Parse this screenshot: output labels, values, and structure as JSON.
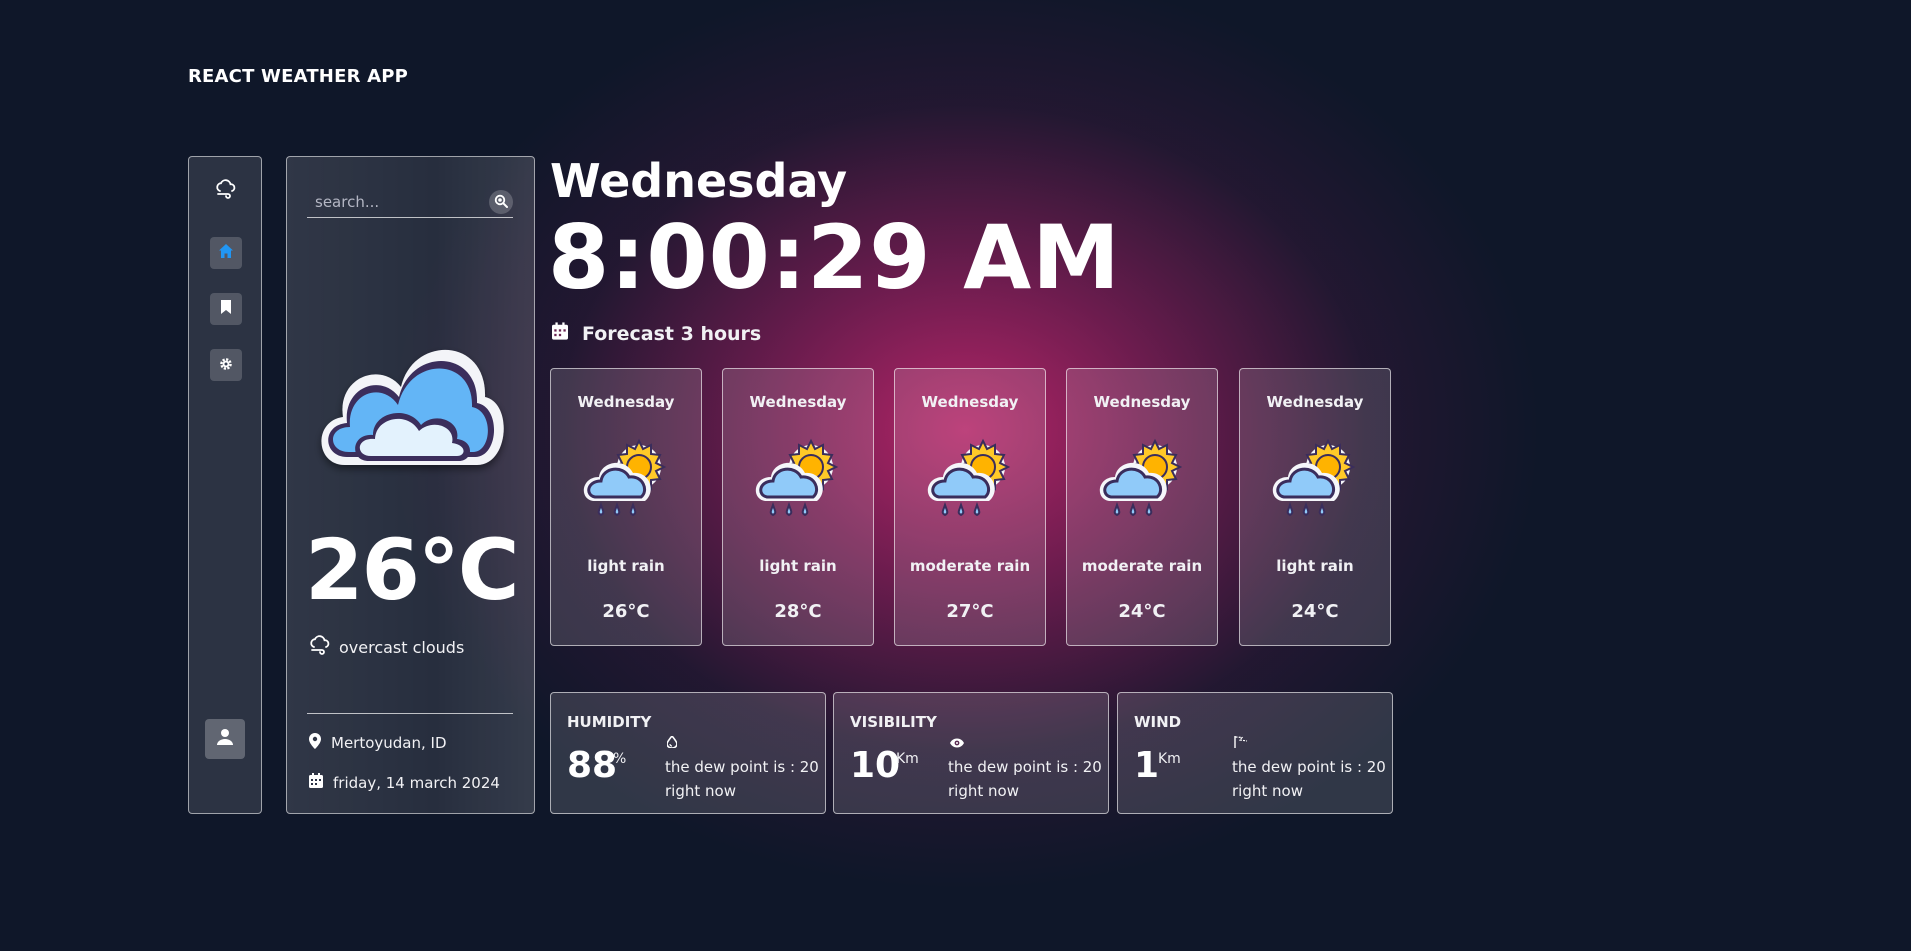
{
  "app": {
    "title": "REACT WEATHER APP"
  },
  "nav": {
    "items": [
      {
        "icon": "cloud-wind-icon"
      },
      {
        "icon": "home-icon",
        "active": true
      },
      {
        "icon": "bookmark-icon"
      },
      {
        "icon": "gear-icon"
      }
    ],
    "avatar_icon": "user-icon"
  },
  "search": {
    "placeholder": "search..."
  },
  "current": {
    "temperature": "26°C",
    "condition": "overcast clouds",
    "location": "Mertoyudan, ID",
    "date": "friday, 14 march 2024"
  },
  "header": {
    "day": "Wednesday",
    "time": "8:00:29 AM"
  },
  "forecast": {
    "title": "Forecast 3 hours",
    "items": [
      {
        "day": "Wednesday",
        "desc": "light rain",
        "temp": "26°C"
      },
      {
        "day": "Wednesday",
        "desc": "light rain",
        "temp": "28°C"
      },
      {
        "day": "Wednesday",
        "desc": "moderate rain",
        "temp": "27°C"
      },
      {
        "day": "Wednesday",
        "desc": "moderate rain",
        "temp": "24°C"
      },
      {
        "day": "Wednesday",
        "desc": "light rain",
        "temp": "24°C"
      }
    ]
  },
  "stats": [
    {
      "label": "HUMIDITY",
      "value": "88",
      "unit": "%",
      "icon": "droplet-icon",
      "note_line1": "the dew point is : 20",
      "note_line2": "right now"
    },
    {
      "label": "VISIBILITY",
      "value": "10",
      "unit": "Km",
      "icon": "eye-icon",
      "note_line1": "the dew point is : 20",
      "note_line2": "right now"
    },
    {
      "label": "WIND",
      "value": "1",
      "unit": "Km",
      "icon": "wind-flag-icon",
      "note_line1": "the dew point is : 20",
      "note_line2": "right now"
    }
  ],
  "colors": {
    "background": "#0f1729",
    "glow": "#c0266c",
    "accent_blue": "#2196f3",
    "cloud_blue": "#64b5f6"
  }
}
